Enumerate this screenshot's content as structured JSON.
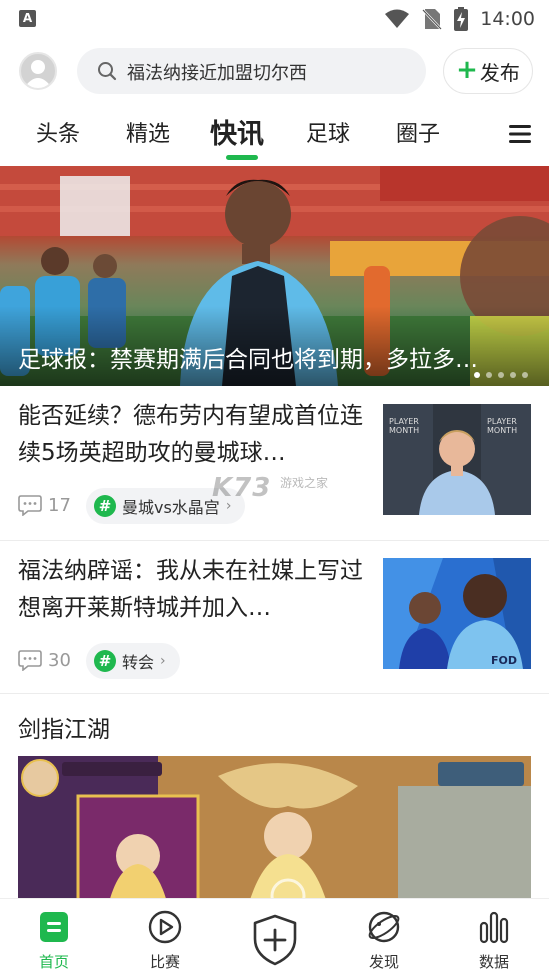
{
  "status_bar": {
    "app_letter": "A",
    "time": "14:00"
  },
  "header": {
    "search_text": "福法纳接近加盟切尔西",
    "publish_label": "发布"
  },
  "tabs": [
    {
      "label": "头条"
    },
    {
      "label": "精选"
    },
    {
      "label": "快讯"
    },
    {
      "label": "足球"
    },
    {
      "label": "圈子"
    }
  ],
  "hero": {
    "title": "足球报：禁赛期满后合同也将到期，多拉多…"
  },
  "articles": [
    {
      "title": "能否延续？德布劳内有望成首位连续5场英超助攻的曼城球…",
      "comments": "17",
      "tag": "曼城vs水晶宫"
    },
    {
      "title": "福法纳辟谣：我从未在社媒上写过想离开莱斯特城并加入…",
      "comments": "30",
      "tag": "转会"
    }
  ],
  "watermark": {
    "brand": "K73",
    "sub": "游戏之家"
  },
  "game": {
    "title": "剑指江湖"
  },
  "bottom_nav": [
    {
      "label": "首页",
      "icon": "home-icon",
      "active": true
    },
    {
      "label": "比赛",
      "icon": "play-icon",
      "active": false
    },
    {
      "label": "",
      "icon": "shield-plus-icon",
      "active": false
    },
    {
      "label": "发现",
      "icon": "discover-icon",
      "active": false
    },
    {
      "label": "数据",
      "icon": "bar-chart-icon",
      "active": false
    }
  ],
  "colors": {
    "accent": "#1fb84e",
    "text": "#222222",
    "muted": "#999999"
  }
}
